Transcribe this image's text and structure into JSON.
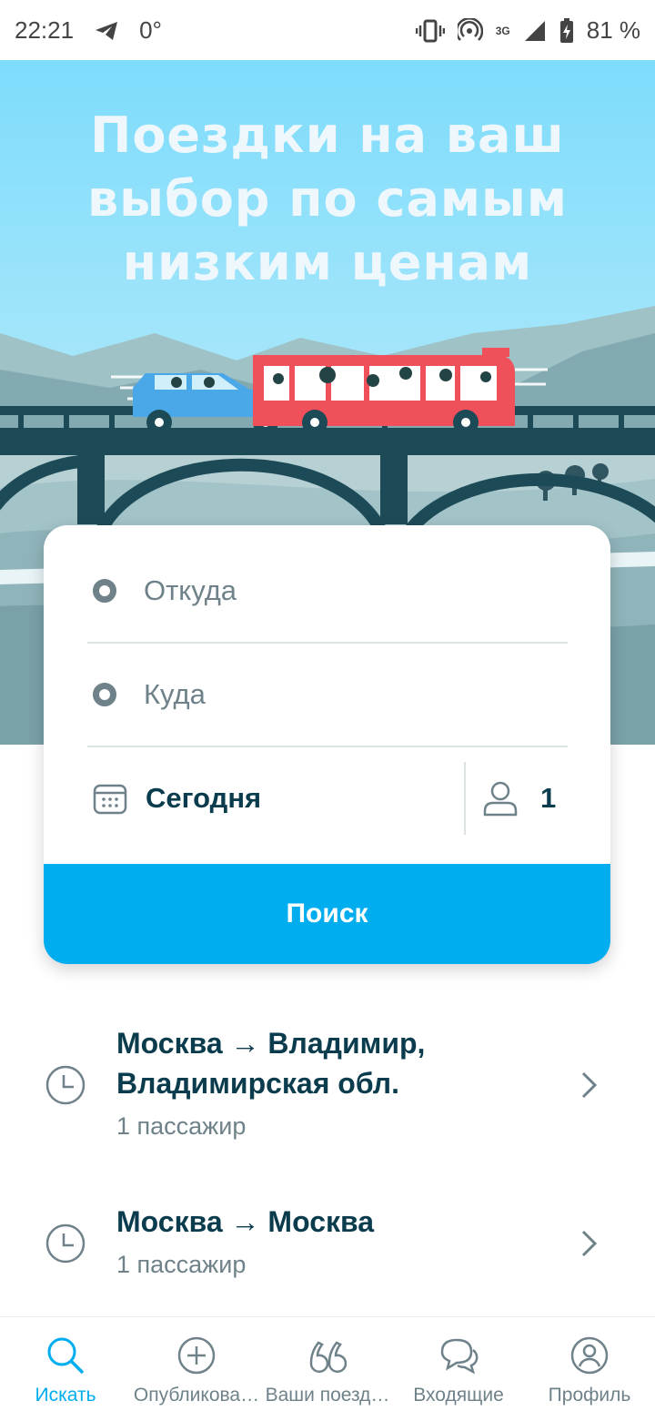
{
  "status_bar": {
    "time": "22:21",
    "temperature": "0°",
    "network": "3G",
    "battery": "81 %"
  },
  "hero": {
    "title_lines": [
      "Поездки на ваш",
      "выбор по самым",
      "низким ценам"
    ]
  },
  "search_form": {
    "from_placeholder": "Откуда",
    "to_placeholder": "Куда",
    "date": "Сегодня",
    "passengers": "1",
    "search_button": "Поиск"
  },
  "recent_searches": [
    {
      "route_line1": "Москва → Владимир,",
      "route_line2": "Владимирская обл.",
      "passengers": "1 пассажир"
    },
    {
      "route_line1": "Москва → Москва",
      "route_line2": "",
      "passengers": "1 пассажир"
    }
  ],
  "bottom_nav": [
    {
      "label": "Искать",
      "icon": "search-icon",
      "active": true
    },
    {
      "label": "Опубликова…",
      "icon": "plus-circle-icon",
      "active": false
    },
    {
      "label": "Ваши поезд…",
      "icon": "trips-icon",
      "active": false
    },
    {
      "label": "Входящие",
      "icon": "chat-icon",
      "active": false
    },
    {
      "label": "Профиль",
      "icon": "profile-icon",
      "active": false
    }
  ],
  "colors": {
    "accent": "#00adef",
    "dark_text": "#0b3c4d",
    "muted_text": "#6f8289",
    "bus": "#f0505a",
    "car": "#4aa8e8"
  }
}
